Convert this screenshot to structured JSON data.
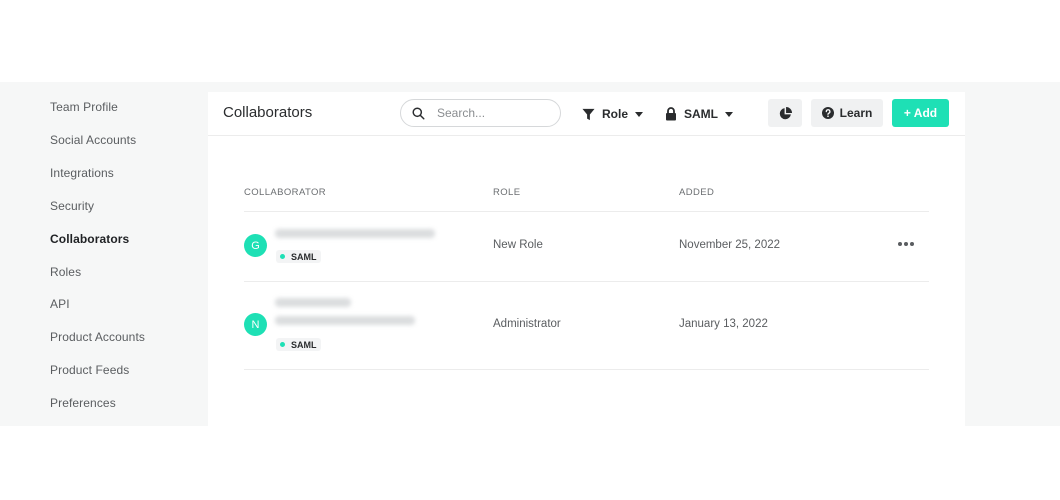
{
  "sidebar": {
    "items": [
      {
        "label": "Team Profile"
      },
      {
        "label": "Social Accounts"
      },
      {
        "label": "Integrations"
      },
      {
        "label": "Security"
      },
      {
        "label": "Collaborators",
        "active": true
      },
      {
        "label": "Roles"
      },
      {
        "label": "API"
      },
      {
        "label": "Product Accounts"
      },
      {
        "label": "Product Feeds"
      },
      {
        "label": "Preferences"
      }
    ]
  },
  "header": {
    "title": "Collaborators",
    "search": {
      "placeholder": "Search...",
      "value": ""
    },
    "role_filter": {
      "label": "Role"
    },
    "saml_filter": {
      "label": "SAML"
    },
    "learn_label": "Learn",
    "add_label": "+ Add"
  },
  "table": {
    "columns": [
      "COLLABORATOR",
      "ROLE",
      "ADDED"
    ],
    "rows": [
      {
        "avatar": "G",
        "badge": "SAML",
        "role": "New Role",
        "added": "November 25, 2022"
      },
      {
        "avatar": "N",
        "badge": "SAML",
        "role": "Administrator",
        "added": "January 13, 2022"
      }
    ]
  },
  "colors": {
    "accent": "#1ee0b5",
    "sidebar_bg": "#f6f7f7",
    "panel_bg": "#ffffff"
  },
  "icons": {
    "search": "search-icon",
    "role": "filter-funnel-icon",
    "saml": "lock-icon",
    "report": "pie-chart-icon",
    "learn": "question-circle-icon",
    "row_menu": "more-horizontal-icon"
  }
}
